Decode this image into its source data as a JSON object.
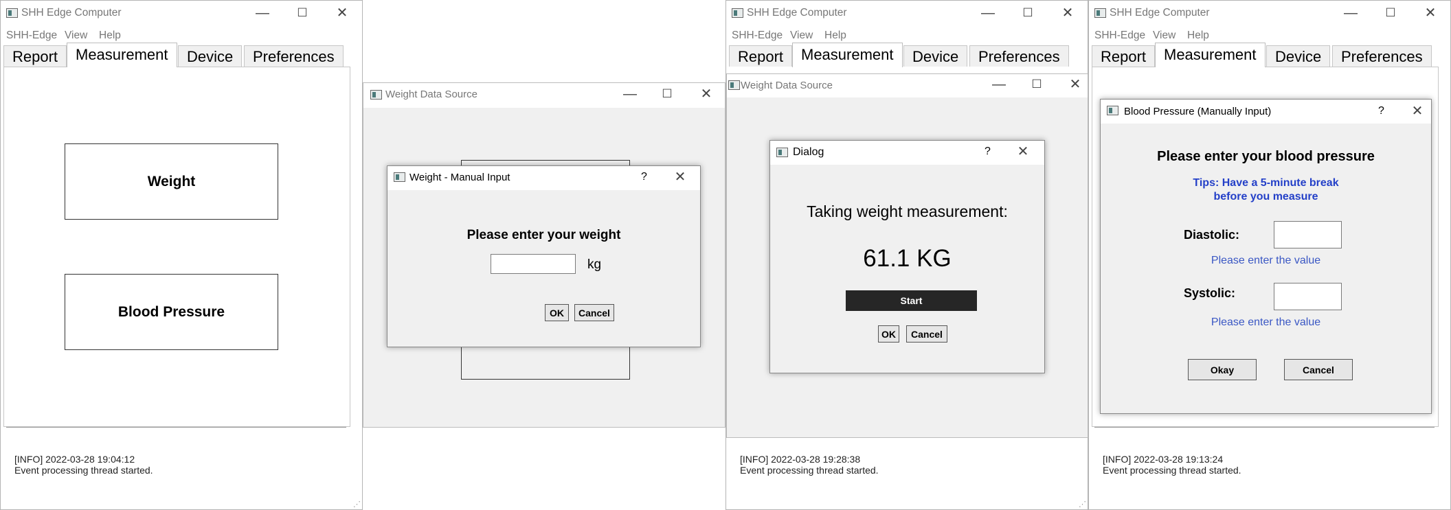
{
  "app": {
    "title": "SHH Edge Computer",
    "menu": [
      "SHH-Edge",
      "View",
      "Help"
    ],
    "tabs": [
      "Report",
      "Measurement",
      "Device",
      "Preferences"
    ]
  },
  "panel1": {
    "weight_label": "Weight",
    "bp_label": "Blood Pressure",
    "log_line1": "[INFO] 2022-03-28 19:04:12",
    "log_line2": "Event processing thread started."
  },
  "panel2": {
    "window_title": "Weight Data Source",
    "dialog_title": "Weight - Manual Input",
    "help": "?",
    "prompt": "Please enter your weight",
    "input_value": "",
    "unit": "kg",
    "ok": "OK",
    "cancel": "Cancel"
  },
  "panel3": {
    "window_title": "Weight Data Source",
    "dialog_title": "Dialog",
    "help": "?",
    "heading": "Taking weight measurement:",
    "reading": "61.1 KG",
    "start": "Start",
    "ok": "OK",
    "cancel": "Cancel",
    "log_line1": "[INFO] 2022-03-28 19:28:38",
    "log_line2": "Event processing thread started."
  },
  "panel4": {
    "dialog_title": "Blood Pressure (Manually Input)",
    "help": "?",
    "heading": "Please enter your blood pressure",
    "tips_line1": "Tips: Have a 5-minute break",
    "tips_line2": "before you measure",
    "diastolic_label": "Diastolic:",
    "diastolic_value": "",
    "diastolic_hint": "Please enter the value",
    "systolic_label": "Systolic:",
    "systolic_value": "",
    "systolic_hint": "Please enter the value",
    "okay": "Okay",
    "cancel": "Cancel",
    "log_line1": "[INFO] 2022-03-28 19:13:24",
    "log_line2": "Event processing thread started."
  },
  "controls": {
    "minimize": "—",
    "maximize": "☐",
    "close": "✕"
  },
  "colors": {
    "tips": "#2440c8",
    "hint": "#3a57c4",
    "start_bg": "#262626"
  }
}
